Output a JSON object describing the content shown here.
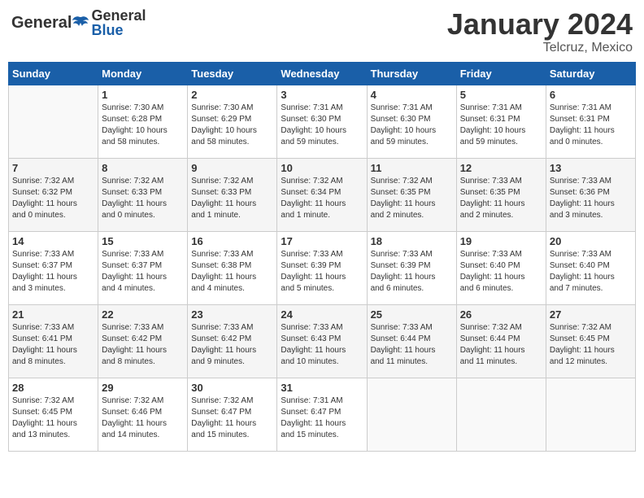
{
  "header": {
    "logo_general": "General",
    "logo_blue": "Blue",
    "month_title": "January 2024",
    "location": "Telcruz, Mexico"
  },
  "days_of_week": [
    "Sunday",
    "Monday",
    "Tuesday",
    "Wednesday",
    "Thursday",
    "Friday",
    "Saturday"
  ],
  "weeks": [
    [
      {
        "day": "",
        "info": ""
      },
      {
        "day": "1",
        "info": "Sunrise: 7:30 AM\nSunset: 6:28 PM\nDaylight: 10 hours\nand 58 minutes."
      },
      {
        "day": "2",
        "info": "Sunrise: 7:30 AM\nSunset: 6:29 PM\nDaylight: 10 hours\nand 58 minutes."
      },
      {
        "day": "3",
        "info": "Sunrise: 7:31 AM\nSunset: 6:30 PM\nDaylight: 10 hours\nand 59 minutes."
      },
      {
        "day": "4",
        "info": "Sunrise: 7:31 AM\nSunset: 6:30 PM\nDaylight: 10 hours\nand 59 minutes."
      },
      {
        "day": "5",
        "info": "Sunrise: 7:31 AM\nSunset: 6:31 PM\nDaylight: 10 hours\nand 59 minutes."
      },
      {
        "day": "6",
        "info": "Sunrise: 7:31 AM\nSunset: 6:31 PM\nDaylight: 11 hours\nand 0 minutes."
      }
    ],
    [
      {
        "day": "7",
        "info": "Sunrise: 7:32 AM\nSunset: 6:32 PM\nDaylight: 11 hours\nand 0 minutes."
      },
      {
        "day": "8",
        "info": "Sunrise: 7:32 AM\nSunset: 6:33 PM\nDaylight: 11 hours\nand 0 minutes."
      },
      {
        "day": "9",
        "info": "Sunrise: 7:32 AM\nSunset: 6:33 PM\nDaylight: 11 hours\nand 1 minute."
      },
      {
        "day": "10",
        "info": "Sunrise: 7:32 AM\nSunset: 6:34 PM\nDaylight: 11 hours\nand 1 minute."
      },
      {
        "day": "11",
        "info": "Sunrise: 7:32 AM\nSunset: 6:35 PM\nDaylight: 11 hours\nand 2 minutes."
      },
      {
        "day": "12",
        "info": "Sunrise: 7:33 AM\nSunset: 6:35 PM\nDaylight: 11 hours\nand 2 minutes."
      },
      {
        "day": "13",
        "info": "Sunrise: 7:33 AM\nSunset: 6:36 PM\nDaylight: 11 hours\nand 3 minutes."
      }
    ],
    [
      {
        "day": "14",
        "info": "Sunrise: 7:33 AM\nSunset: 6:37 PM\nDaylight: 11 hours\nand 3 minutes."
      },
      {
        "day": "15",
        "info": "Sunrise: 7:33 AM\nSunset: 6:37 PM\nDaylight: 11 hours\nand 4 minutes."
      },
      {
        "day": "16",
        "info": "Sunrise: 7:33 AM\nSunset: 6:38 PM\nDaylight: 11 hours\nand 4 minutes."
      },
      {
        "day": "17",
        "info": "Sunrise: 7:33 AM\nSunset: 6:39 PM\nDaylight: 11 hours\nand 5 minutes."
      },
      {
        "day": "18",
        "info": "Sunrise: 7:33 AM\nSunset: 6:39 PM\nDaylight: 11 hours\nand 6 minutes."
      },
      {
        "day": "19",
        "info": "Sunrise: 7:33 AM\nSunset: 6:40 PM\nDaylight: 11 hours\nand 6 minutes."
      },
      {
        "day": "20",
        "info": "Sunrise: 7:33 AM\nSunset: 6:40 PM\nDaylight: 11 hours\nand 7 minutes."
      }
    ],
    [
      {
        "day": "21",
        "info": "Sunrise: 7:33 AM\nSunset: 6:41 PM\nDaylight: 11 hours\nand 8 minutes."
      },
      {
        "day": "22",
        "info": "Sunrise: 7:33 AM\nSunset: 6:42 PM\nDaylight: 11 hours\nand 8 minutes."
      },
      {
        "day": "23",
        "info": "Sunrise: 7:33 AM\nSunset: 6:42 PM\nDaylight: 11 hours\nand 9 minutes."
      },
      {
        "day": "24",
        "info": "Sunrise: 7:33 AM\nSunset: 6:43 PM\nDaylight: 11 hours\nand 10 minutes."
      },
      {
        "day": "25",
        "info": "Sunrise: 7:33 AM\nSunset: 6:44 PM\nDaylight: 11 hours\nand 11 minutes."
      },
      {
        "day": "26",
        "info": "Sunrise: 7:32 AM\nSunset: 6:44 PM\nDaylight: 11 hours\nand 11 minutes."
      },
      {
        "day": "27",
        "info": "Sunrise: 7:32 AM\nSunset: 6:45 PM\nDaylight: 11 hours\nand 12 minutes."
      }
    ],
    [
      {
        "day": "28",
        "info": "Sunrise: 7:32 AM\nSunset: 6:45 PM\nDaylight: 11 hours\nand 13 minutes."
      },
      {
        "day": "29",
        "info": "Sunrise: 7:32 AM\nSunset: 6:46 PM\nDaylight: 11 hours\nand 14 minutes."
      },
      {
        "day": "30",
        "info": "Sunrise: 7:32 AM\nSunset: 6:47 PM\nDaylight: 11 hours\nand 15 minutes."
      },
      {
        "day": "31",
        "info": "Sunrise: 7:31 AM\nSunset: 6:47 PM\nDaylight: 11 hours\nand 15 minutes."
      },
      {
        "day": "",
        "info": ""
      },
      {
        "day": "",
        "info": ""
      },
      {
        "day": "",
        "info": ""
      }
    ]
  ]
}
